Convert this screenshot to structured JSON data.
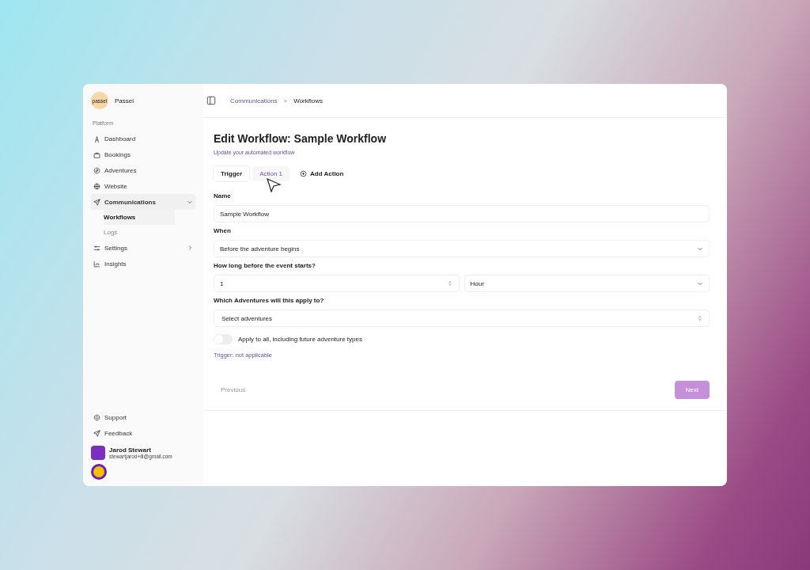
{
  "brand": {
    "logo": "passel",
    "name": "Passel"
  },
  "sidebar": {
    "section": "Platform",
    "items": [
      {
        "label": "Dashboard",
        "selected": false
      },
      {
        "label": "Bookings",
        "selected": false
      },
      {
        "label": "Adventures",
        "selected": false
      },
      {
        "label": "Website",
        "selected": false
      },
      {
        "label": "Communications",
        "selected": false,
        "expanded": true,
        "children": [
          {
            "label": "Workflows",
            "selected": true
          },
          {
            "label": "Logs",
            "selected": false
          }
        ]
      },
      {
        "label": "Settings",
        "selected": false,
        "expanded": false
      },
      {
        "label": "Insights",
        "selected": false
      }
    ],
    "footer": [
      {
        "label": "Support"
      },
      {
        "label": "Feedback"
      }
    ],
    "user": {
      "name": "Jarod Stewart",
      "email": "stewartjarod+lll@gmail.com"
    }
  },
  "breadcrumb": {
    "items": [
      "Communications",
      "Workflows"
    ],
    "separator": ">"
  },
  "page": {
    "title": "Edit Workflow: Sample Workflow",
    "subtitle": "Update your automated workflow"
  },
  "tabs": [
    {
      "label": "Trigger",
      "kind": "tab",
      "selected": true
    },
    {
      "label": "Action 1",
      "kind": "tab",
      "selected": false
    },
    {
      "label": "Add Action",
      "kind": "add"
    }
  ],
  "form": {
    "name": {
      "label": "Name",
      "value": "Sample Workflow"
    },
    "when": {
      "label": "When",
      "value": "Before the adventure begins"
    },
    "how_long": {
      "label": "How long before the event starts?",
      "value": "1",
      "unit": "Hour"
    },
    "adventures": {
      "label": "Which Adventures will this apply to?",
      "placeholder": "Select adventures"
    },
    "apply_all": {
      "label": "Apply to all, including future adventure types",
      "on": false
    },
    "note": "Trigger: not applicable"
  },
  "buttons": [
    {
      "label": "Previous",
      "disabled": true
    },
    {
      "label": "Next",
      "disabled": false
    }
  ]
}
